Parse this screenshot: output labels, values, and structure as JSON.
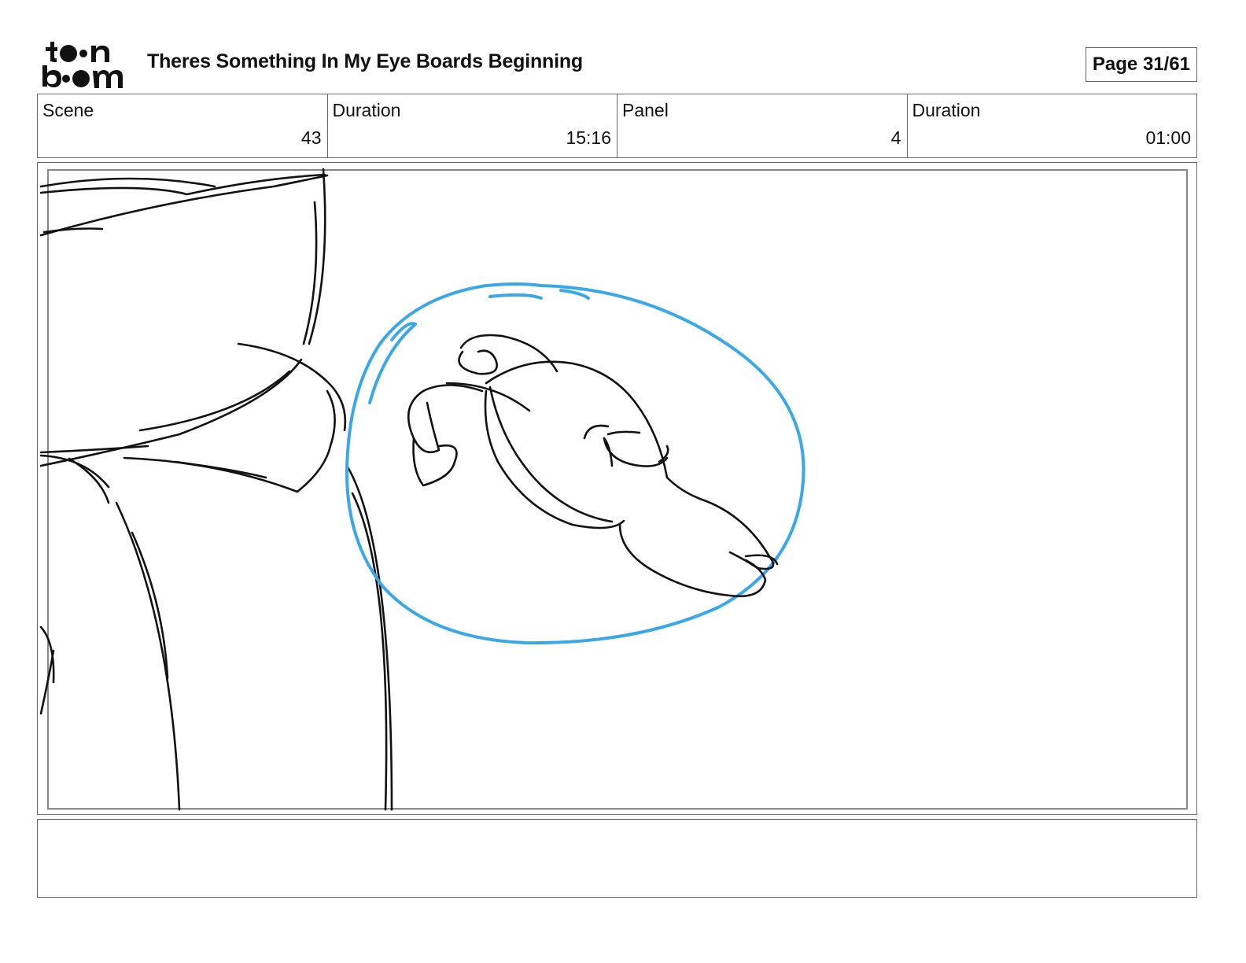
{
  "header": {
    "logo_text": "toon boom",
    "title": "Theres Something In My Eye Boards Beginning",
    "page_label": "Page 31/61"
  },
  "info": [
    {
      "label": "Scene",
      "value": "43"
    },
    {
      "label": "Duration",
      "value": "15:16"
    },
    {
      "label": "Panel",
      "value": "4"
    },
    {
      "label": "Duration",
      "value": "01:00"
    }
  ],
  "panel": {
    "highlight_color": "#3aa8e8",
    "line_color": "#111111"
  },
  "notes": {
    "text": ""
  }
}
